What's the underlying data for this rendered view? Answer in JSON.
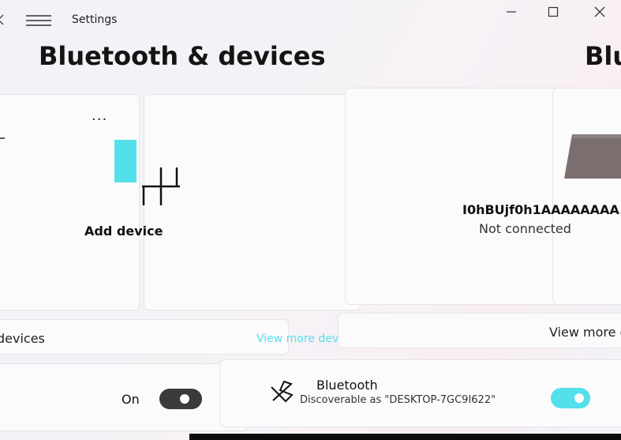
{
  "titlebar": {
    "title": "Settings"
  },
  "page": {
    "title": "Bluetooth & devices",
    "title_partial": "Blu"
  },
  "add_card": {
    "more": "...",
    "label": "Add device"
  },
  "device_card": {
    "name": "I0hBUjf0h1AAAAAAAA...",
    "status": "Not connected"
  },
  "view_more": {
    "left_label": "devices",
    "link": "View more devices",
    "right_label": "View more d"
  },
  "bluetooth_left": {
    "state": "On",
    "toggle_on": true
  },
  "bluetooth_right": {
    "title": "Bluetooth",
    "subtitle": "Discoverable as \"DESKTOP-7GC9I622\"",
    "toggle_on": true
  },
  "icons": {
    "back": "back-arrow-icon",
    "menu": "hamburger-menu-icon",
    "minimize": "minimize-icon",
    "maximize": "maximize-icon",
    "close": "close-icon",
    "add_device": "add-device-icon",
    "bluetooth": "bluetooth-icon",
    "device": "device-icon"
  },
  "colors": {
    "accent": "#54e0ea",
    "toggle_off_track": "#3a3a3a",
    "device_icon": "#7a6e6e"
  }
}
